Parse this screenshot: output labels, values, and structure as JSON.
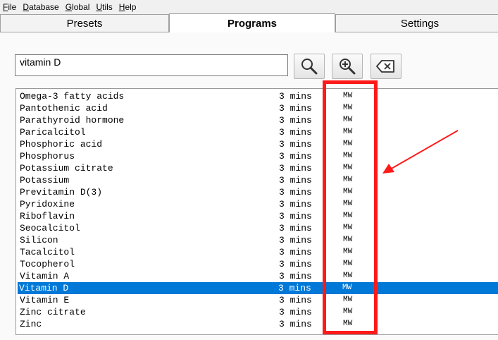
{
  "menubar": {
    "items": [
      "File",
      "Database",
      "Global",
      "Utils",
      "Help"
    ]
  },
  "tabs": [
    {
      "label": "Presets",
      "selected": false
    },
    {
      "label": "Programs",
      "selected": true
    },
    {
      "label": "Settings",
      "selected": false
    }
  ],
  "search": {
    "value": "vitamin D"
  },
  "toolbar": {
    "search_icon": "search-icon",
    "zoom_icon": "zoom-in-icon",
    "clear_icon": "backspace-icon"
  },
  "programs": {
    "selected_index": 16,
    "rows": [
      {
        "name": "Omega-3 fatty acids",
        "duration": "3 mins",
        "mode": "MW"
      },
      {
        "name": "Pantothenic acid",
        "duration": "3 mins",
        "mode": "MW"
      },
      {
        "name": "Parathyroid hormone",
        "duration": "3 mins",
        "mode": "MW"
      },
      {
        "name": "Paricalcitol",
        "duration": "3 mins",
        "mode": "MW"
      },
      {
        "name": "Phosphoric acid",
        "duration": "3 mins",
        "mode": "MW"
      },
      {
        "name": "Phosphorus",
        "duration": "3 mins",
        "mode": "MW"
      },
      {
        "name": "Potassium citrate",
        "duration": "3 mins",
        "mode": "MW"
      },
      {
        "name": "Potassium",
        "duration": "3 mins",
        "mode": "MW"
      },
      {
        "name": "Previtamin D(3)",
        "duration": "3 mins",
        "mode": "MW"
      },
      {
        "name": "Pyridoxine",
        "duration": "3 mins",
        "mode": "MW"
      },
      {
        "name": "Riboflavin",
        "duration": "3 mins",
        "mode": "MW"
      },
      {
        "name": "Seocalcitol",
        "duration": "3 mins",
        "mode": "MW"
      },
      {
        "name": "Silicon",
        "duration": "3 mins",
        "mode": "MW"
      },
      {
        "name": "Tacalcitol",
        "duration": "3 mins",
        "mode": "MW"
      },
      {
        "name": "Tocopherol",
        "duration": "3 mins",
        "mode": "MW"
      },
      {
        "name": "Vitamin A",
        "duration": "3 mins",
        "mode": "MW"
      },
      {
        "name": "Vitamin D",
        "duration": "3 mins",
        "mode": "MW"
      },
      {
        "name": "Vitamin E",
        "duration": "3 mins",
        "mode": "MW"
      },
      {
        "name": "Zinc citrate",
        "duration": "3 mins",
        "mode": "MW"
      },
      {
        "name": "Zinc",
        "duration": "3 mins",
        "mode": "MW"
      }
    ]
  },
  "annotation": {
    "color": "#ff1a1a"
  },
  "colors": {
    "selection": "#0078d7"
  }
}
